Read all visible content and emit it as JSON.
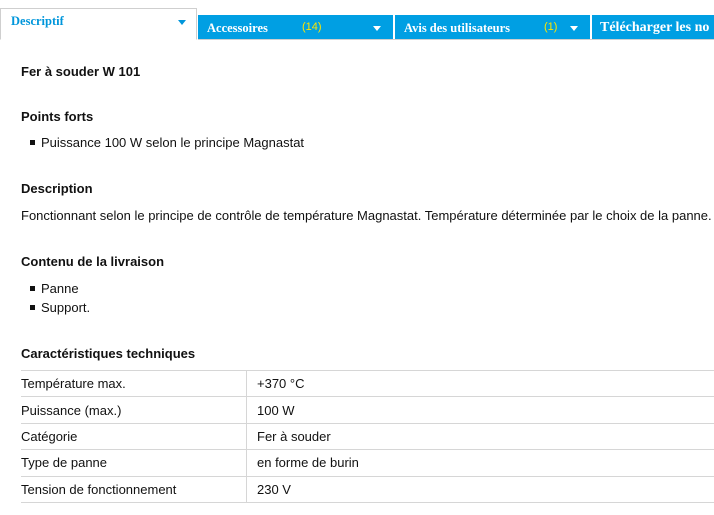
{
  "tabs": [
    {
      "label": "Descriptif",
      "count": "",
      "active": true
    },
    {
      "label": "Accessoires",
      "count": "(14)",
      "active": false
    },
    {
      "label": "Avis des utilisateurs",
      "count": "(1)",
      "active": false
    },
    {
      "label": "Télécharger les no",
      "count": "",
      "active": false
    }
  ],
  "product": {
    "title": "Fer à souder W 101"
  },
  "sections": {
    "highlights": {
      "heading": "Points forts",
      "items": [
        "Puissance 100 W selon le principe Magnastat"
      ]
    },
    "description": {
      "heading": "Description",
      "text": "Fonctionnant selon le principe de contrôle de température Magnastat. Température déterminée par le choix de la panne."
    },
    "delivery": {
      "heading": "Contenu de la livraison",
      "items": [
        "Panne",
        "Support."
      ]
    },
    "specs": {
      "heading": "Caractéristiques techniques",
      "rows": [
        {
          "key": "Température max.",
          "value": "+370 °C"
        },
        {
          "key": "Puissance (max.)",
          "value": "100 W"
        },
        {
          "key": "Catégorie",
          "value": "Fer à souder"
        },
        {
          "key": "Type de panne",
          "value": "en forme de burin"
        },
        {
          "key": "Tension de fonctionnement",
          "value": "230 V"
        }
      ]
    }
  },
  "colors": {
    "tab_blue": "#009fe3",
    "count_yellow": "#ffe600",
    "active_text": "#0096db"
  },
  "icons": {
    "tab_dropdown": "chevron-down-icon",
    "bullet": "square-bullet-icon"
  }
}
